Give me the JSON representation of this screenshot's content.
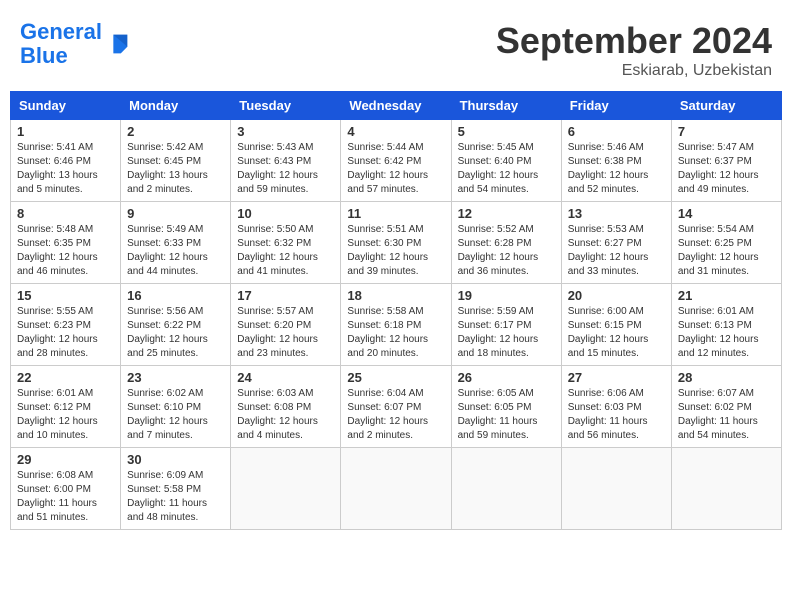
{
  "header": {
    "logo_general": "General",
    "logo_blue": "Blue",
    "month": "September 2024",
    "location": "Eskiarab, Uzbekistan"
  },
  "days_of_week": [
    "Sunday",
    "Monday",
    "Tuesday",
    "Wednesday",
    "Thursday",
    "Friday",
    "Saturday"
  ],
  "weeks": [
    [
      {
        "day": 1,
        "sunrise": "5:41 AM",
        "sunset": "6:46 PM",
        "daylight": "13 hours and 5 minutes."
      },
      {
        "day": 2,
        "sunrise": "5:42 AM",
        "sunset": "6:45 PM",
        "daylight": "13 hours and 2 minutes."
      },
      {
        "day": 3,
        "sunrise": "5:43 AM",
        "sunset": "6:43 PM",
        "daylight": "12 hours and 59 minutes."
      },
      {
        "day": 4,
        "sunrise": "5:44 AM",
        "sunset": "6:42 PM",
        "daylight": "12 hours and 57 minutes."
      },
      {
        "day": 5,
        "sunrise": "5:45 AM",
        "sunset": "6:40 PM",
        "daylight": "12 hours and 54 minutes."
      },
      {
        "day": 6,
        "sunrise": "5:46 AM",
        "sunset": "6:38 PM",
        "daylight": "12 hours and 52 minutes."
      },
      {
        "day": 7,
        "sunrise": "5:47 AM",
        "sunset": "6:37 PM",
        "daylight": "12 hours and 49 minutes."
      }
    ],
    [
      {
        "day": 8,
        "sunrise": "5:48 AM",
        "sunset": "6:35 PM",
        "daylight": "12 hours and 46 minutes."
      },
      {
        "day": 9,
        "sunrise": "5:49 AM",
        "sunset": "6:33 PM",
        "daylight": "12 hours and 44 minutes."
      },
      {
        "day": 10,
        "sunrise": "5:50 AM",
        "sunset": "6:32 PM",
        "daylight": "12 hours and 41 minutes."
      },
      {
        "day": 11,
        "sunrise": "5:51 AM",
        "sunset": "6:30 PM",
        "daylight": "12 hours and 39 minutes."
      },
      {
        "day": 12,
        "sunrise": "5:52 AM",
        "sunset": "6:28 PM",
        "daylight": "12 hours and 36 minutes."
      },
      {
        "day": 13,
        "sunrise": "5:53 AM",
        "sunset": "6:27 PM",
        "daylight": "12 hours and 33 minutes."
      },
      {
        "day": 14,
        "sunrise": "5:54 AM",
        "sunset": "6:25 PM",
        "daylight": "12 hours and 31 minutes."
      }
    ],
    [
      {
        "day": 15,
        "sunrise": "5:55 AM",
        "sunset": "6:23 PM",
        "daylight": "12 hours and 28 minutes."
      },
      {
        "day": 16,
        "sunrise": "5:56 AM",
        "sunset": "6:22 PM",
        "daylight": "12 hours and 25 minutes."
      },
      {
        "day": 17,
        "sunrise": "5:57 AM",
        "sunset": "6:20 PM",
        "daylight": "12 hours and 23 minutes."
      },
      {
        "day": 18,
        "sunrise": "5:58 AM",
        "sunset": "6:18 PM",
        "daylight": "12 hours and 20 minutes."
      },
      {
        "day": 19,
        "sunrise": "5:59 AM",
        "sunset": "6:17 PM",
        "daylight": "12 hours and 18 minutes."
      },
      {
        "day": 20,
        "sunrise": "6:00 AM",
        "sunset": "6:15 PM",
        "daylight": "12 hours and 15 minutes."
      },
      {
        "day": 21,
        "sunrise": "6:01 AM",
        "sunset": "6:13 PM",
        "daylight": "12 hours and 12 minutes."
      }
    ],
    [
      {
        "day": 22,
        "sunrise": "6:01 AM",
        "sunset": "6:12 PM",
        "daylight": "12 hours and 10 minutes."
      },
      {
        "day": 23,
        "sunrise": "6:02 AM",
        "sunset": "6:10 PM",
        "daylight": "12 hours and 7 minutes."
      },
      {
        "day": 24,
        "sunrise": "6:03 AM",
        "sunset": "6:08 PM",
        "daylight": "12 hours and 4 minutes."
      },
      {
        "day": 25,
        "sunrise": "6:04 AM",
        "sunset": "6:07 PM",
        "daylight": "12 hours and 2 minutes."
      },
      {
        "day": 26,
        "sunrise": "6:05 AM",
        "sunset": "6:05 PM",
        "daylight": "11 hours and 59 minutes."
      },
      {
        "day": 27,
        "sunrise": "6:06 AM",
        "sunset": "6:03 PM",
        "daylight": "11 hours and 56 minutes."
      },
      {
        "day": 28,
        "sunrise": "6:07 AM",
        "sunset": "6:02 PM",
        "daylight": "11 hours and 54 minutes."
      }
    ],
    [
      {
        "day": 29,
        "sunrise": "6:08 AM",
        "sunset": "6:00 PM",
        "daylight": "11 hours and 51 minutes."
      },
      {
        "day": 30,
        "sunrise": "6:09 AM",
        "sunset": "5:58 PM",
        "daylight": "11 hours and 48 minutes."
      },
      null,
      null,
      null,
      null,
      null
    ]
  ]
}
